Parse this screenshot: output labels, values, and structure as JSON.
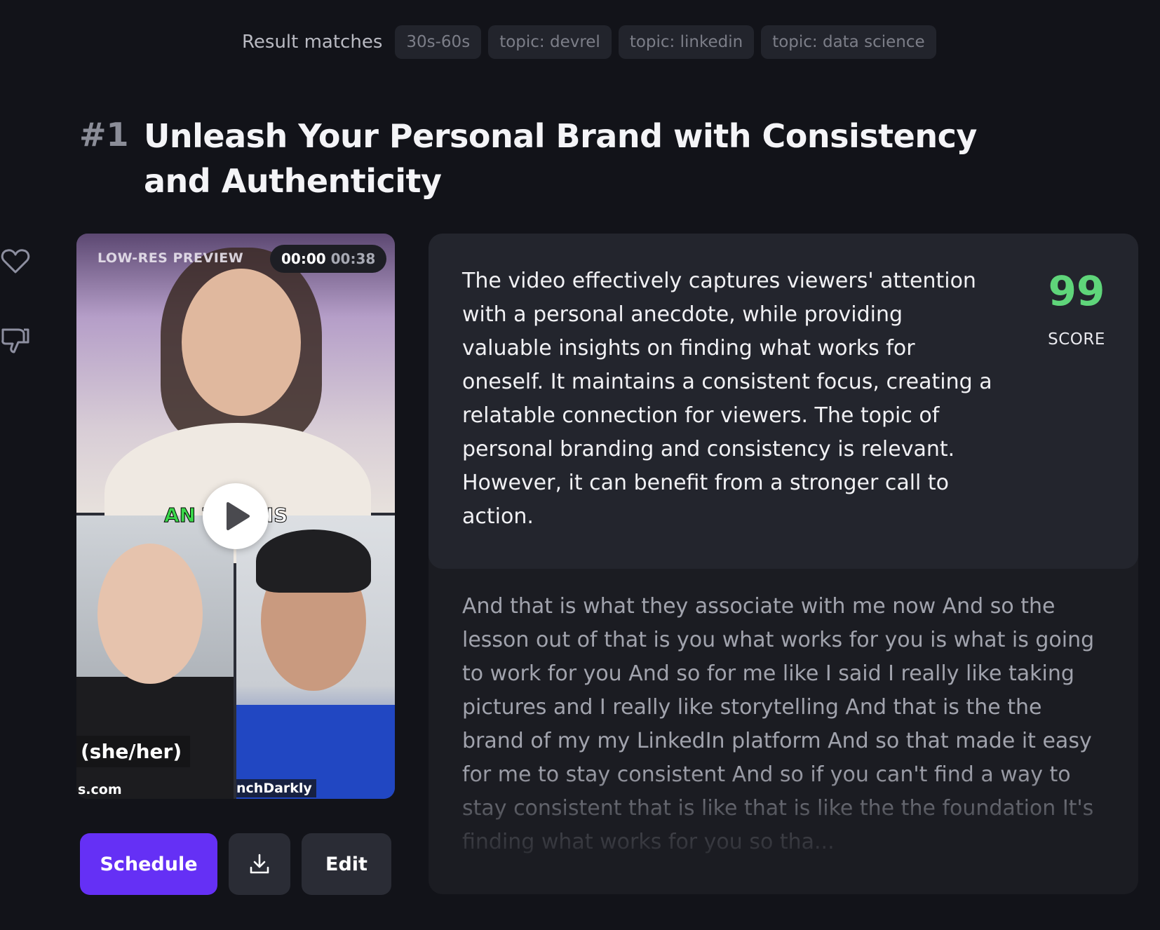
{
  "filters": {
    "label": "Result matches",
    "chips": [
      "30s-60s",
      "topic: devrel",
      "topic: linkedin",
      "topic: data science"
    ]
  },
  "result": {
    "rank": "#1",
    "title": "Unleash Your Personal Brand with Consistency and Authenticity"
  },
  "video": {
    "preview_label": "LOW-RES PREVIEW",
    "current_time": "00:00",
    "duration": "00:38",
    "caption_green": "AN",
    "caption_rest": "THAT IS",
    "name_tag": "(she/her)",
    "domain_left": "s.com",
    "domain_right": "nchDarkly"
  },
  "actions": {
    "schedule_label": "Schedule",
    "edit_label": "Edit",
    "download_icon": "download-icon"
  },
  "side_actions": {
    "like_icon": "heart-icon",
    "dislike_icon": "thumbs-down-icon"
  },
  "analysis": {
    "text": "The video effectively captures viewers' attention with a personal anecdote, while providing valuable insights on finding what works for oneself. It maintains a consistent focus, creating a relatable connection for viewers. The topic of personal branding and consistency is relevant. However, it can benefit from a stronger call to action.",
    "score": "99",
    "score_label": "SCORE"
  },
  "transcript": {
    "text": "And that is what they associate with me now And so the lesson out of that is you what works for you is what is going to work for you And so for me like I said I really like taking pictures and I really like storytelling And that is the the brand of my my LinkedIn platform And so that made it easy for me to stay consistent And so if you can't find a way to stay consistent that is like that is like the the foundation It's finding what works for you so tha..."
  },
  "colors": {
    "background": "#121319",
    "primary_button": "#6530f5",
    "score_green": "#5fd57a"
  }
}
